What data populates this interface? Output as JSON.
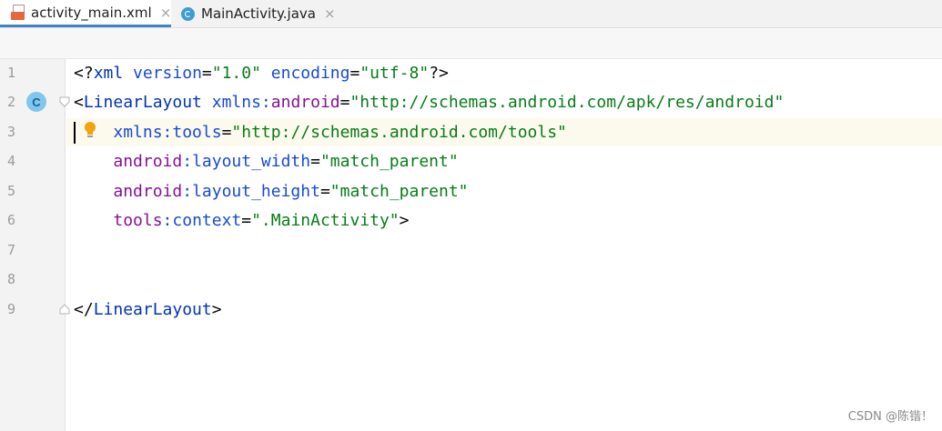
{
  "tabs": [
    {
      "label": "activity_main.xml",
      "icon": "xml-file-icon",
      "active": true,
      "close": "×"
    },
    {
      "label": "MainActivity.java",
      "icon": "java-class-icon",
      "active": false,
      "close": "×"
    }
  ],
  "gutter": {
    "line_numbers": [
      "1",
      "2",
      "3",
      "4",
      "5",
      "6",
      "7",
      "8",
      "9"
    ],
    "class_marker": "C"
  },
  "code": {
    "line1": {
      "open": "<?",
      "tag": "xml",
      "sp1": " ",
      "attr1": "version",
      "eq1": "=",
      "val1": "\"1.0\"",
      "sp2": " ",
      "attr2": "encoding",
      "eq2": "=",
      "val2": "\"utf-8\"",
      "close": "?>"
    },
    "line2": {
      "open": "<",
      "tag": "LinearLayout",
      "sp": " ",
      "ns_attr": "xmlns:",
      "ns": "android",
      "eq": "=",
      "val": "\"http://schemas.android.com/apk/res/android\""
    },
    "line3": {
      "indent": "    ",
      "attr": "xmlns:tools",
      "eq": "=",
      "val": "\"http://schemas.android.com/tools\""
    },
    "line4": {
      "indent": "    ",
      "ns": "android",
      "colon": ":",
      "attr": "layout_width",
      "eq": "=",
      "val": "\"match_parent\""
    },
    "line5": {
      "indent": "    ",
      "ns": "android",
      "colon": ":",
      "attr": "layout_height",
      "eq": "=",
      "val": "\"match_parent\""
    },
    "line6": {
      "indent": "    ",
      "ns": "tools",
      "colon": ":",
      "attr": "context",
      "eq": "=",
      "val": "\".MainActivity\"",
      "close": ">"
    },
    "line7": "",
    "line8": "",
    "line9": {
      "open": "</",
      "tag": "LinearLayout",
      "close": ">"
    }
  },
  "watermark": "CSDN @陈锴！",
  "colors": {
    "tag": "#0033b3",
    "attribute": "#174ad4",
    "namespace": "#871094",
    "string_value": "#067d17",
    "active_tab_underline": "#4083c9",
    "current_line_bg": "#fcfaed"
  }
}
